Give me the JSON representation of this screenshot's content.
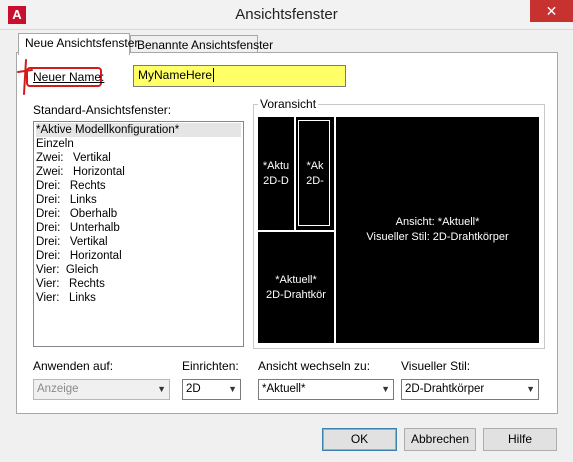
{
  "window": {
    "title": "Ansichtsfenster",
    "app_icon": "A",
    "close_symbol": "✕"
  },
  "tabs": [
    {
      "label": "Neue Ansichtsfenster"
    },
    {
      "label": "Benannte Ansichtsfenster"
    }
  ],
  "name_field": {
    "label": "Neuer Name:",
    "value": "MyNameHere"
  },
  "standard": {
    "label": "Standard-Ansichtsfenster:",
    "items": [
      "*Aktive Modellkonfiguration*",
      "Einzeln",
      "Zwei:   Vertikal",
      "Zwei:   Horizontal",
      "Drei:   Rechts",
      "Drei:   Links",
      "Drei:   Oberhalb",
      "Drei:   Unterhalb",
      "Drei:   Vertikal",
      "Drei:   Horizontal",
      "Vier:  Gleich",
      "Vier:   Rechts",
      "Vier:   Links"
    ]
  },
  "preview": {
    "label": "Voransicht",
    "vp1": {
      "line1": "*Aktu",
      "line2": "2D-D"
    },
    "vp2": {
      "line1": "*Ak",
      "line2": "2D-"
    },
    "vp3": {
      "line1": "*Aktuell*",
      "line2": "2D-Drahtkör"
    },
    "vp_main": {
      "line1": "Ansicht: *Aktuell*",
      "line2": "Visueller Stil: 2D-Drahtkörper"
    }
  },
  "apply": {
    "label": "Anwenden auf:",
    "value": "Anzeige"
  },
  "setup": {
    "label": "Einrichten:",
    "value": "2D"
  },
  "change_view": {
    "label": "Ansicht wechseln zu:",
    "value": "*Aktuell*"
  },
  "visual_style": {
    "label": "Visueller Stil:",
    "value": "2D-Drahtkörper"
  },
  "buttons": {
    "ok": "OK",
    "cancel": "Abbrechen",
    "help": "Hilfe"
  },
  "colors": {
    "highlight": "#ffff66",
    "annotation_red": "#d41a1a",
    "viewport_bg": "#000000"
  }
}
